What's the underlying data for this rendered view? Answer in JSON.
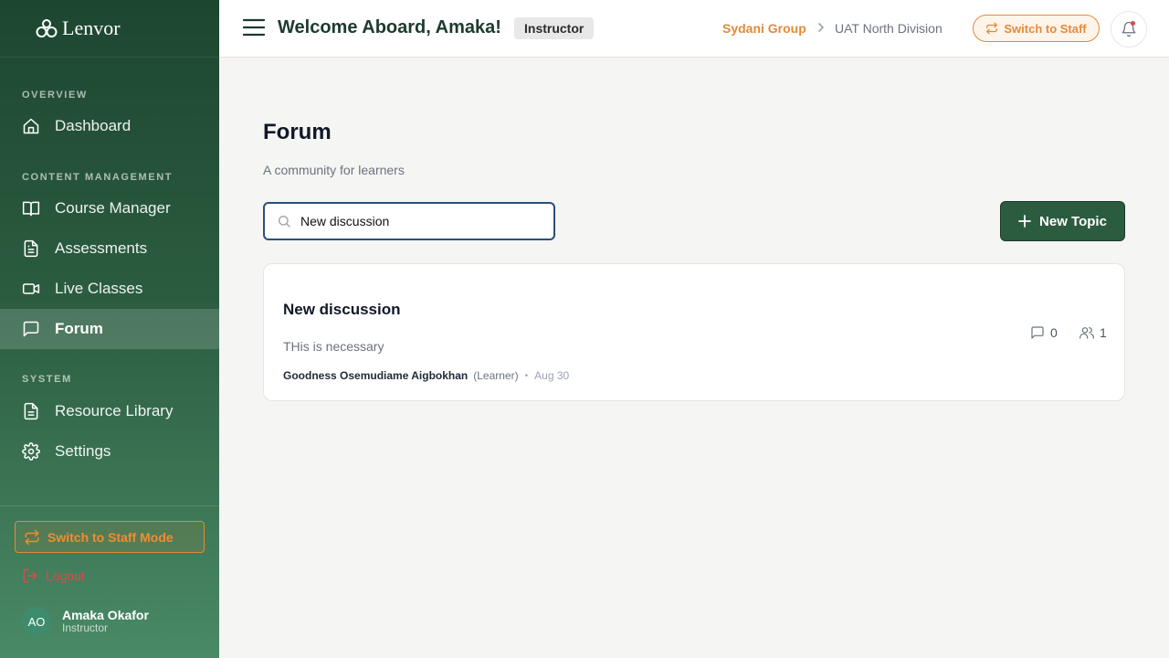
{
  "brand": {
    "name": "Lenvor"
  },
  "sidebar": {
    "sections": [
      {
        "label": "OVERVIEW"
      },
      {
        "label": "CONTENT MANAGEMENT"
      },
      {
        "label": "SYSTEM"
      }
    ],
    "items": [
      {
        "label": "Dashboard",
        "icon": "home-icon"
      },
      {
        "label": "Course Manager",
        "icon": "book-icon"
      },
      {
        "label": "Assessments",
        "icon": "document-icon"
      },
      {
        "label": "Live Classes",
        "icon": "video-icon"
      },
      {
        "label": "Forum",
        "icon": "chat-icon",
        "active": true
      },
      {
        "label": "Resource Library",
        "icon": "file-icon"
      },
      {
        "label": "Settings",
        "icon": "gear-icon"
      }
    ],
    "switch_mode_label": "Switch to Staff Mode",
    "logout_label": "Logout",
    "user": {
      "initials": "AO",
      "name": "Amaka Okafor",
      "role": "Instructor"
    }
  },
  "header": {
    "welcome": "Welcome Aboard, Amaka!",
    "role_badge": "Instructor",
    "breadcrumb": {
      "org": "Sydani Group",
      "division": "UAT North Division"
    },
    "switch_label": "Switch to Staff"
  },
  "main": {
    "title": "Forum",
    "subtitle": "A community for learners",
    "search": {
      "value": "New discussion",
      "placeholder": ""
    },
    "new_topic_label": "New Topic",
    "topics": [
      {
        "title": "New discussion",
        "body": "THis is necessary",
        "author": "Goodness Osemudiame Aigbokhan",
        "author_role": "(Learner)",
        "date": "Aug 30",
        "comments": "0",
        "participants": "1"
      }
    ]
  },
  "colors": {
    "sidebar_dark": "#1d4630",
    "accent_orange": "#e38a3a",
    "primary_green": "#2b5c40",
    "danger": "#e04848"
  }
}
